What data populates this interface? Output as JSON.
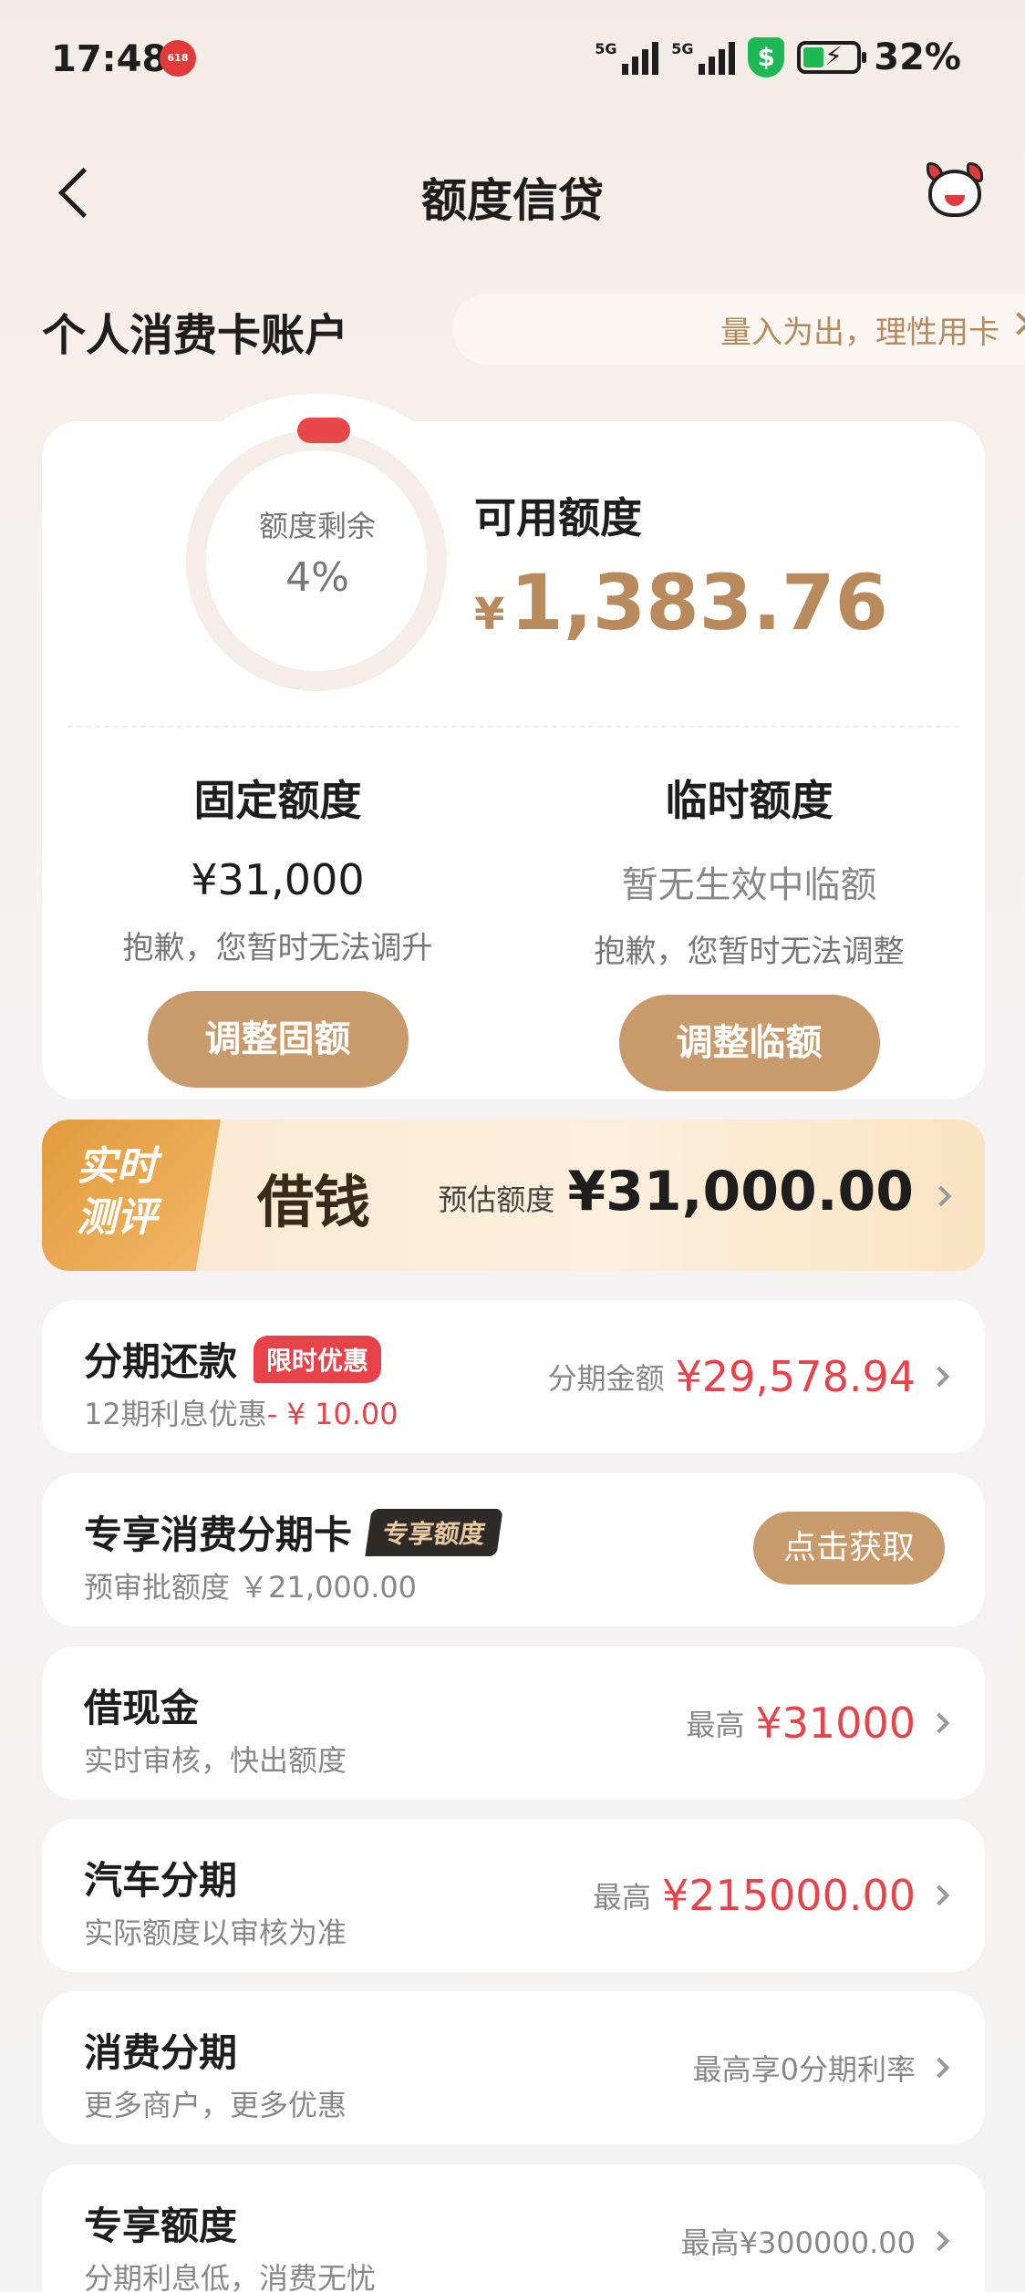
{
  "status_bar": {
    "time": "17:48",
    "app_badge": "618",
    "net1": "5G",
    "net2": "5G",
    "battery": "32%",
    "icons": [
      "signal-icon",
      "signal-icon",
      "security-shield-icon",
      "battery-charging-icon"
    ]
  },
  "header": {
    "title": "额度信贷",
    "back_icon": "back-arrow-icon",
    "mascot_icon": "mascot-avatar-icon"
  },
  "account": {
    "title": "个人消费卡账户",
    "tip": "量入为出，理性用卡"
  },
  "quota": {
    "ring_label": "额度剩余",
    "ring_percent": "4%",
    "remaining_fraction": 0.04,
    "available_label": "可用额度",
    "available_currency": "¥",
    "available_amount": "1,383.76",
    "fixed": {
      "title": "固定额度",
      "value": "¥31,000",
      "desc": "抱歉，您暂时无法调升",
      "button": "调整固额"
    },
    "temp": {
      "title": "临时额度",
      "value": "暂无生效中临额",
      "desc": "抱歉，您暂时无法调整",
      "button": "调整临额"
    }
  },
  "borrow": {
    "tag_line1": "实时",
    "tag_line2": "测评",
    "name": "借钱",
    "est_label": "预估额度",
    "est_amount": "¥31,000.00"
  },
  "items": [
    {
      "name": "分期还款",
      "badge": "限时优惠",
      "sub": "12期利息优惠",
      "sub_minus": "- ¥ 10.00",
      "right_label": "分期金额",
      "right_amount": "¥29,578.94"
    },
    {
      "name": "专享消费分期卡",
      "badge": "专享额度",
      "sub": "预审批额度 ￥21,000.00",
      "button": "点击获取"
    },
    {
      "name": "借现金",
      "sub": "实时审核，快出额度",
      "right_label": "最高",
      "right_amount": "¥31000"
    },
    {
      "name": "汽车分期",
      "sub": "实际额度以审核为准",
      "right_label": "最高",
      "right_amount": "¥215000.00"
    },
    {
      "name": "消费分期",
      "sub": "更多商户，更多优惠",
      "right_plain": "最高享0分期利率"
    },
    {
      "name": "专享额度",
      "sub": "分期利息低，消费无忧",
      "right_plain": "最高¥300000.00"
    }
  ],
  "colors": {
    "accent_gold": "#c99a6b",
    "amount_gold": "#b88a5c",
    "red": "#e8434a",
    "background": "#f4f3f3"
  }
}
